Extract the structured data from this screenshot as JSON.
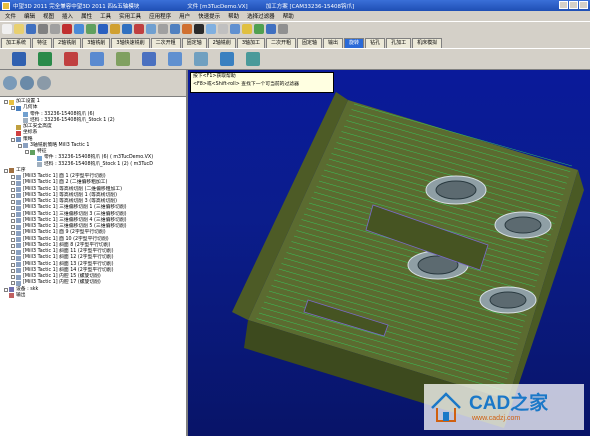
{
  "titlebar": {
    "app": "中望3D 2011 完全兼容中望3D 2011 四&五轴模块",
    "file": "文件 [m3TucDemo.VX]",
    "part": "加工方案 [CAM33236-15408钩爪]"
  },
  "menu": [
    "文件",
    "编辑",
    "视图",
    "插入",
    "属性",
    "工具",
    "实用工具",
    "应用程序",
    "用户",
    "快速提示",
    "帮助",
    "选择过滤器",
    "帮助"
  ],
  "tabs": [
    "加工系统",
    "特征",
    "2轴铣削",
    "3轴铣削",
    "3轴快速铣削",
    "二次开粗",
    "固定轴",
    "2轴铣削",
    "3轴加工",
    "二次开粗",
    "固定轴",
    "输出",
    "旋转",
    "钻孔",
    "孔加工",
    "机床模拟"
  ],
  "active_tab": "旋转",
  "tooltip": {
    "line1": "按下<F1>获取帮助",
    "line2": "<F8>或<Shift-roll> 查找下一个可当前的过滤器"
  },
  "tree": [
    {
      "indent": 0,
      "exp": "-",
      "icon": "folder-icon",
      "text": "加工设置 1"
    },
    {
      "indent": 1,
      "exp": "-",
      "icon": "geometry-icon",
      "text": "几何体"
    },
    {
      "indent": 2,
      "exp": "",
      "icon": "part-icon",
      "text": "零件 : 33236-15408钩爪 (6)"
    },
    {
      "indent": 2,
      "exp": "",
      "icon": "stock-icon",
      "text": "坯料 : 33236-15408钩爪_Stock 1 (2)"
    },
    {
      "indent": 1,
      "exp": "",
      "icon": "safety-icon",
      "text": "加工安全高度"
    },
    {
      "indent": 1,
      "exp": "",
      "icon": "coord-icon",
      "text": "坐标系"
    },
    {
      "indent": 1,
      "exp": "-",
      "icon": "strategy-icon",
      "text": "策略"
    },
    {
      "indent": 2,
      "exp": "-",
      "icon": "op-icon",
      "text": "3轴铣削策略   Mill3 Tactic 1"
    },
    {
      "indent": 3,
      "exp": "-",
      "icon": "feature-icon",
      "text": "特征"
    },
    {
      "indent": 4,
      "exp": "",
      "icon": "part-icon",
      "text": "零件 : 33236-15408钩爪 (6) ( m3TucDemo.VX)"
    },
    {
      "indent": 4,
      "exp": "",
      "icon": "stock-icon",
      "text": "坯料 : 33236-15408钩爪_Stock 1 (2) ( m3TucD"
    },
    {
      "indent": 0,
      "exp": "-",
      "icon": "process-icon",
      "text": "工序"
    },
    {
      "indent": 1,
      "exp": "+",
      "icon": "op-icon",
      "text": "[Mill3 Tactic 1] 面 1 (2字型平行切削)"
    },
    {
      "indent": 1,
      "exp": "+",
      "icon": "op-icon",
      "text": "[Mill3 Tactic 1] 面 2 (二维偏移粗加工)"
    },
    {
      "indent": 1,
      "exp": "+",
      "icon": "op-icon",
      "text": "[Mill3 Tactic 1] 等高线切削 (二维偏移粗加工)"
    },
    {
      "indent": 1,
      "exp": "+",
      "icon": "op-icon",
      "text": "[Mill3 Tactic 1] 等高线切削 1 (等高线切削)"
    },
    {
      "indent": 1,
      "exp": "+",
      "icon": "op-icon",
      "text": "[Mill3 Tactic 1] 等高线切削 3 (等高线切削)"
    },
    {
      "indent": 1,
      "exp": "+",
      "icon": "op-icon",
      "text": "[Mill3 Tactic 1] 三维偏移切削 1 (三维偏移切削)"
    },
    {
      "indent": 1,
      "exp": "+",
      "icon": "op-icon",
      "text": "[Mill3 Tactic 1] 三维偏移切削 3 (三维偏移切削)"
    },
    {
      "indent": 1,
      "exp": "+",
      "icon": "op-icon",
      "text": "[Mill3 Tactic 1] 三维偏移切削 4 (三维偏移切削)"
    },
    {
      "indent": 1,
      "exp": "+",
      "icon": "op-icon",
      "text": "[Mill3 Tactic 1] 三维偏移切削 5 (三维偏移切削)"
    },
    {
      "indent": 1,
      "exp": "+",
      "icon": "op-icon",
      "text": "[Mill3 Tactic 1] 面 9 (2字型平行切削)"
    },
    {
      "indent": 1,
      "exp": "+",
      "icon": "op-icon",
      "text": "[Mill3 Tactic 1] 面 10 (2字型平行切削)"
    },
    {
      "indent": 1,
      "exp": "+",
      "icon": "op-icon",
      "text": "[Mill3 Tactic 1] 斜面 8 (2字型平行切削)"
    },
    {
      "indent": 1,
      "exp": "+",
      "icon": "op-icon",
      "text": "[Mill3 Tactic 1] 斜面 11 (2字型平行切削)"
    },
    {
      "indent": 1,
      "exp": "+",
      "icon": "op-icon",
      "text": "[Mill3 Tactic 1] 斜面 12 (2字型平行切削)"
    },
    {
      "indent": 1,
      "exp": "+",
      "icon": "op-icon",
      "text": "[Mill3 Tactic 1] 斜面 13 (2字型平行切削)"
    },
    {
      "indent": 1,
      "exp": "+",
      "icon": "op-icon",
      "text": "[Mill3 Tactic 1] 斜面 14 (2字型平行切削)"
    },
    {
      "indent": 1,
      "exp": "+",
      "icon": "op-icon",
      "text": "[Mill3 Tactic 1] 内腔 15 (螺旋切削)"
    },
    {
      "indent": 1,
      "exp": "+",
      "icon": "op-icon",
      "text": "[Mill3 Tactic 1] 内腔 17 (螺旋切削)"
    },
    {
      "indent": 0,
      "exp": "+",
      "icon": "equipment-icon",
      "text": "设备 : skk"
    },
    {
      "indent": 0,
      "exp": "",
      "icon": "output-icon",
      "text": "输出"
    }
  ],
  "watermark": {
    "title": "CAD之家",
    "url": "www.cadzj.com"
  },
  "colors": {
    "viewport_bg": "#0b1d8c",
    "model": "#6e7f3e",
    "toolpath": "#34d060",
    "tab_active": "#2a6ad8"
  }
}
